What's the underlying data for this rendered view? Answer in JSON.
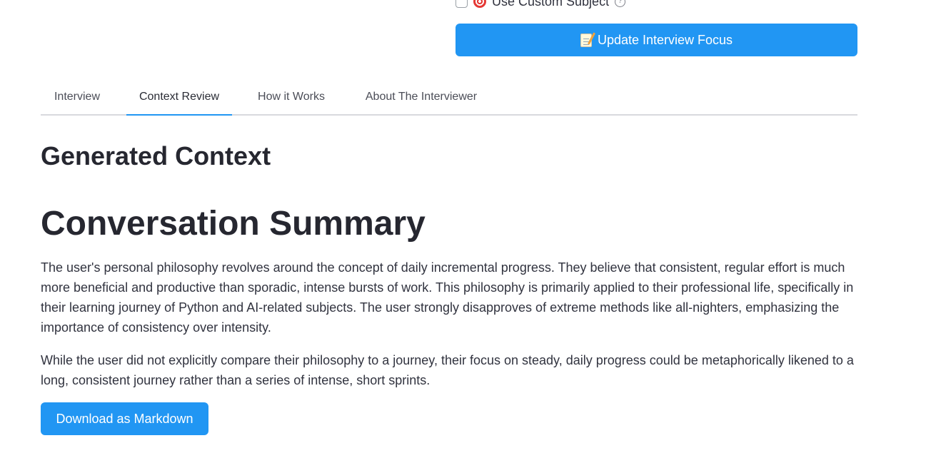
{
  "top_controls": {
    "checkbox_label": "Use Custom Subject",
    "checkbox_checked": false,
    "checkbox_icon": "target-icon",
    "help_icon": "help-icon",
    "update_button_label": "Update Interview Focus",
    "update_button_icon": "memo-icon"
  },
  "tabs": [
    {
      "label": "Interview"
    },
    {
      "label": "Context Review",
      "active": true
    },
    {
      "label": "How it Works"
    },
    {
      "label": "About The Interviewer"
    }
  ],
  "content": {
    "generated_title": "Generated Context",
    "summary_title": "Conversation Summary",
    "paragraphs": [
      "The user's personal philosophy revolves around the concept of daily incremental progress. They believe that consistent, regular effort is much more beneficial and productive than sporadic, intense bursts of work. This philosophy is primarily applied to their professional life, specifically in their learning journey of Python and AI-related subjects. The user strongly disapproves of extreme methods like all-nighters, emphasizing the importance of consistency over intensity.",
      "While the user did not explicitly compare their philosophy to a journey, their focus on steady, daily progress could be metaphorically likened to a long, consistent journey rather than a series of intense, short sprints."
    ],
    "download_button_label": "Download as Markdown"
  },
  "colors": {
    "primary": "#2196f3",
    "text": "#262730",
    "tab_border": "#d8d9de"
  }
}
